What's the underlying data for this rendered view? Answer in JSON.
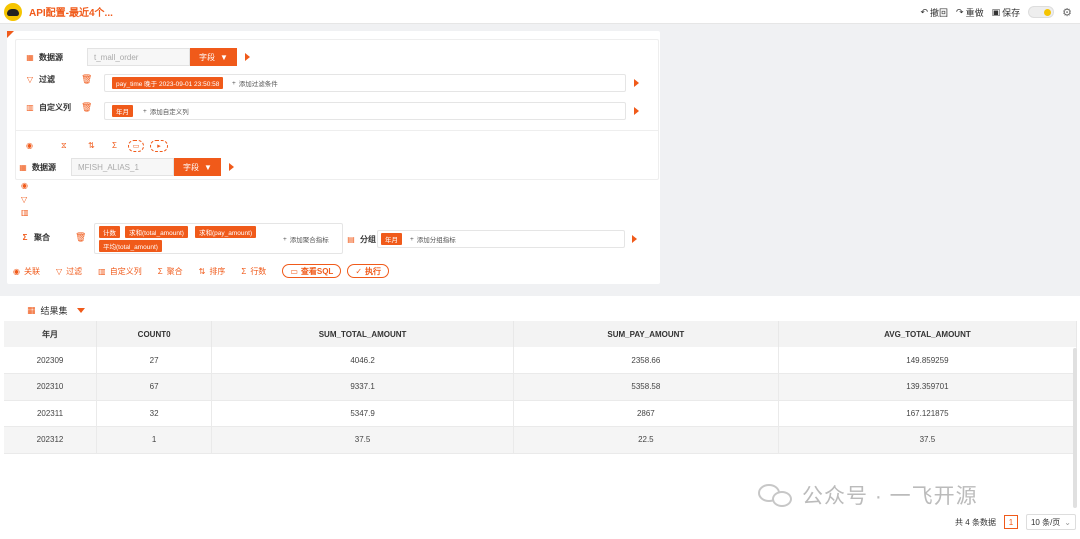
{
  "app": {
    "title": "API配置-最近4个..."
  },
  "topbar": {
    "undo": "撤回",
    "redo": "重做",
    "save": "保存"
  },
  "block1": {
    "datasource_label": "数据源",
    "datasource_value": "t_mall_order",
    "field_button": "字段",
    "filter_label": "过滤",
    "filter_tag": "pay_time 晚于 2023-09-01 23:50:58",
    "add_filter": "添加过滤条件",
    "custom_col_label": "自定义列",
    "custom_col_tag": "年月",
    "add_custom_col": "添加自定义列"
  },
  "block2": {
    "datasource_label": "数据源",
    "datasource_value": "MFISH_ALIAS_1",
    "field_button": "字段",
    "agg_label": "聚合",
    "agg_tags": [
      "计数",
      "求和(total_amount)",
      "求和(pay_amount)",
      "平均(total_amount)"
    ],
    "add_agg": "添加聚合指标",
    "group_label": "分组",
    "group_tag": "年月",
    "add_group": "添加分组指标"
  },
  "toolbar": {
    "join": "关联",
    "filter": "过滤",
    "custom_col": "自定义列",
    "agg": "聚合",
    "sort": "排序",
    "rows": "行数",
    "view_sql": "查看SQL",
    "run": "执行"
  },
  "results": {
    "title": "结果集",
    "columns": [
      "年月",
      "COUNT0",
      "SUM_TOTAL_AMOUNT",
      "SUM_PAY_AMOUNT",
      "AVG_TOTAL_AMOUNT"
    ],
    "rows": [
      [
        "202309",
        "27",
        "4046.2",
        "2358.66",
        "149.859259"
      ],
      [
        "202310",
        "67",
        "9337.1",
        "5358.58",
        "139.359701"
      ],
      [
        "202311",
        "32",
        "5347.9",
        "2867",
        "167.121875"
      ],
      [
        "202312",
        "1",
        "37.5",
        "22.5",
        "37.5"
      ]
    ],
    "total": "共 4 条数据",
    "page": "1",
    "page_size": "10 条/页"
  },
  "watermark": "公众号 · 一飞开源",
  "colors": {
    "accent": "#f05a1a",
    "brand_yellow": "#f5c400"
  }
}
